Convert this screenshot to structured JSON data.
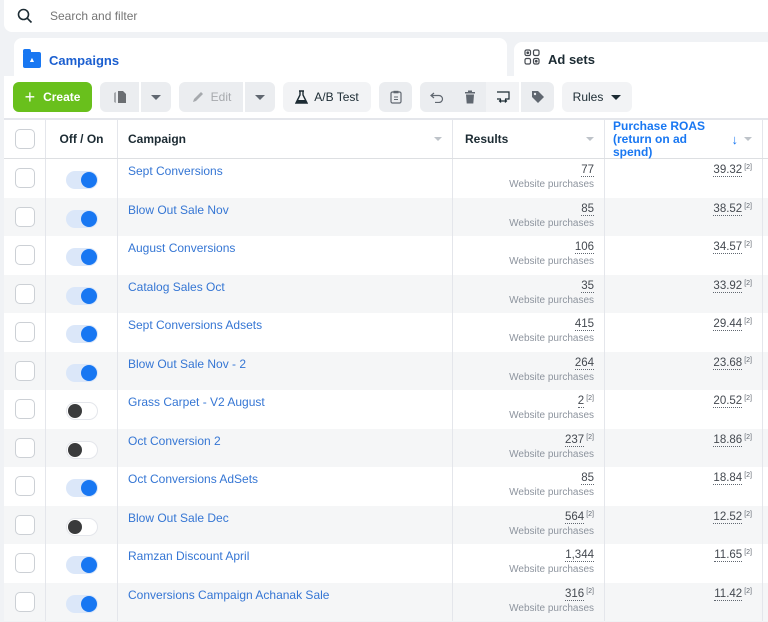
{
  "search": {
    "placeholder": "Search and filter",
    "icon": "search-icon"
  },
  "tabs": [
    {
      "label": "Campaigns",
      "icon": "campaign-folder-icon",
      "active": true
    },
    {
      "label": "Ad sets",
      "icon": "ad-sets-grid-icon",
      "active": false
    }
  ],
  "toolbar": {
    "create_label": "Create",
    "edit_label": "Edit",
    "ab_test_label": "A/B Test",
    "rules_label": "Rules"
  },
  "table": {
    "columns": {
      "toggle": "Off / On",
      "campaign": "Campaign",
      "results": "Results",
      "roas_line1": "Purchase ROAS",
      "roas_line2": "(return on ad spend)"
    },
    "results_sub": "Website purchases",
    "footnote": "[2]",
    "rows": [
      {
        "name": "Sept Conversions",
        "on": true,
        "results": "77",
        "results_note": false,
        "roas": "39.32"
      },
      {
        "name": "Blow Out Sale Nov",
        "on": true,
        "results": "85",
        "results_note": false,
        "roas": "38.52"
      },
      {
        "name": "August Conversions",
        "on": true,
        "results": "106",
        "results_note": false,
        "roas": "34.57"
      },
      {
        "name": "Catalog Sales Oct",
        "on": true,
        "results": "35",
        "results_note": false,
        "roas": "33.92"
      },
      {
        "name": "Sept Conversions Adsets",
        "on": true,
        "results": "415",
        "results_note": false,
        "roas": "29.44"
      },
      {
        "name": "Blow Out Sale Nov - 2",
        "on": true,
        "results": "264",
        "results_note": false,
        "roas": "23.68"
      },
      {
        "name": "Grass Carpet - V2 August",
        "on": false,
        "results": "2",
        "results_note": true,
        "roas": "20.52"
      },
      {
        "name": "Oct Conversion 2",
        "on": false,
        "results": "237",
        "results_note": true,
        "roas": "18.86"
      },
      {
        "name": "Oct Conversions AdSets",
        "on": true,
        "results": "85",
        "results_note": false,
        "roas": "18.84"
      },
      {
        "name": "Blow Out Sale Dec",
        "on": false,
        "results": "564",
        "results_note": true,
        "roas": "12.52"
      },
      {
        "name": "Ramzan Discount April",
        "on": true,
        "results": "1,344",
        "results_note": false,
        "roas": "11.65"
      },
      {
        "name": "Conversions Campaign Achanak Sale",
        "on": true,
        "results": "316",
        "results_note": true,
        "roas": "11.42"
      }
    ]
  },
  "colors": {
    "accent": "#1877f2",
    "create": "#69c01c",
    "link": "#3576d4"
  }
}
